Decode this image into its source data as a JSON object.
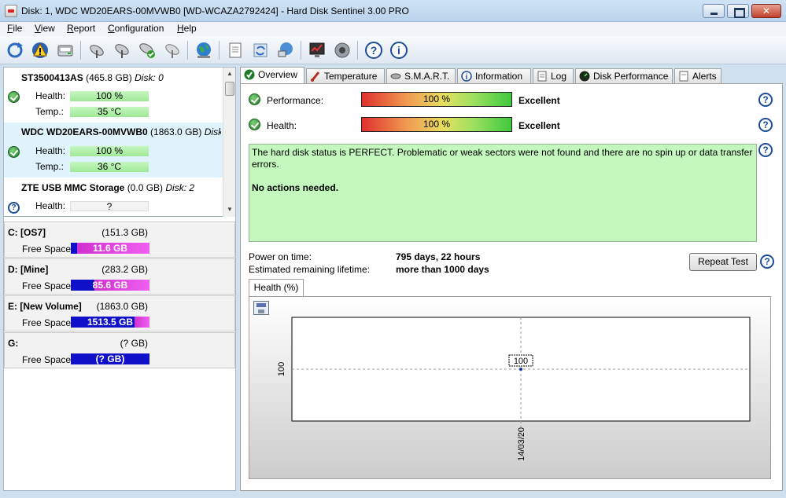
{
  "window": {
    "title": "Disk: 1, WDC WD20EARS-00MVWB0 [WD-WCAZA2792424]  -  Hard Disk Sentinel 3.00 PRO"
  },
  "menu": [
    {
      "u": "F",
      "rest": "ile"
    },
    {
      "u": "V",
      "rest": "iew"
    },
    {
      "u": "R",
      "rest": "eport"
    },
    {
      "u": "C",
      "rest": "onfiguration"
    },
    {
      "u": "H",
      "rest": "elp"
    }
  ],
  "toolbar": {
    "icons": [
      "refresh-icon",
      "alert-icon",
      "disk-icon",
      "satellite-icon",
      "satellite-add-icon",
      "satellite-check-icon",
      "satellite-remove-icon",
      "globe-icon",
      "report-icon",
      "sync-icon",
      "network-icon",
      "monitor-icon",
      "speaker-icon",
      "help-icon",
      "info-icon"
    ]
  },
  "disks": [
    {
      "model": "ST3500413AS",
      "size": "(465.8 GB)",
      "disk": "Disk: 0",
      "health_label": "Health:",
      "health": "100 %",
      "temp_label": "Temp.:",
      "temp": "35 °C",
      "status": "ok"
    },
    {
      "model": "WDC WD20EARS-00MVWB0",
      "size": "(1863.0 GB)",
      "disk": "Disk: 1",
      "health_label": "Health:",
      "health": "100 %",
      "temp_label": "Temp.:",
      "temp": "36 °C",
      "status": "ok"
    },
    {
      "model": "ZTE     USB MMC Storage",
      "size": "(0.0 GB)",
      "disk": "Disk: 2",
      "health_label": "Health:",
      "health": "?",
      "status": "unknown"
    }
  ],
  "volumes": [
    {
      "name": "C: [OS7]",
      "size": "(151.3 GB)",
      "free_label": "Free Space",
      "free": "11.6 GB",
      "used_fraction": 0.92
    },
    {
      "name": "D: [Mine]",
      "size": "(283.2 GB)",
      "free_label": "Free Space",
      "free": "85.6 GB",
      "used_fraction": 0.7
    },
    {
      "name": "E: [New Volume]",
      "size": "(1863.0 GB)",
      "free_label": "Free Space",
      "free": "1513.5 GB",
      "used_fraction": 0.19
    },
    {
      "name": "G:",
      "size": "(? GB)",
      "free_label": "Free Space",
      "free": "(? GB)",
      "used_fraction": 0
    }
  ],
  "tabs": [
    {
      "label": "Overview",
      "icon": "check-icon"
    },
    {
      "label": "Temperature",
      "icon": "thermometer-icon"
    },
    {
      "label": "S.M.A.R.T.",
      "icon": "smart-icon"
    },
    {
      "label": "Information",
      "icon": "info-icon"
    },
    {
      "label": "Log",
      "icon": "log-icon"
    },
    {
      "label": "Disk Performance",
      "icon": "gauge-icon"
    },
    {
      "label": "Alerts",
      "icon": "alerts-icon"
    }
  ],
  "overview": {
    "performance_label": "Performance:",
    "performance_value": "100 %",
    "performance_rating": "Excellent",
    "health_label": "Health:",
    "health_value": "100 %",
    "health_rating": "Excellent",
    "status_text": "The hard disk status is PERFECT. Problematic or weak sectors were not found and there are no spin up or data transfer errors.",
    "action_text": "No actions needed.",
    "power_on_label": "Power on time:",
    "power_on_value": "795 days, 22 hours",
    "lifetime_label": "Estimated remaining lifetime:",
    "lifetime_value": "more than 1000 days",
    "repeat_button": "Repeat Test",
    "subtab": "Health (%)"
  },
  "chart_data": {
    "type": "line",
    "categories": [
      "14/03/20"
    ],
    "series": [
      {
        "values": [
          100
        ]
      }
    ],
    "y_tick": "100",
    "point_label": "100"
  },
  "colors": {
    "status_bg": "#c3f7bd",
    "volume_free": "#1010c8",
    "volume_used": "#e040e0",
    "health_bar": "#b5f0ad"
  }
}
